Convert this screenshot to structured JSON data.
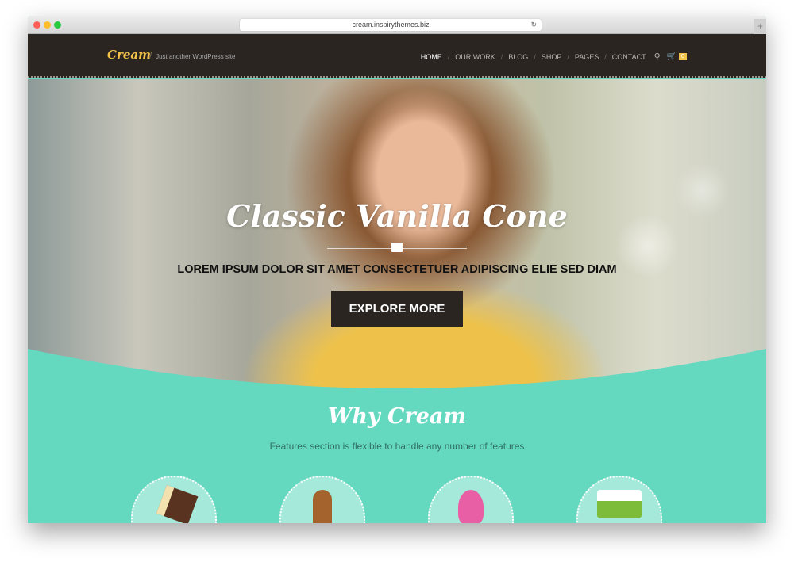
{
  "browser": {
    "url": "cream.inspirythemes.biz"
  },
  "header": {
    "logo": "Cream",
    "tagline": "Just another WordPress site",
    "menu": [
      "HOME",
      "OUR WORK",
      "BLOG",
      "SHOP",
      "PAGES",
      "CONTACT"
    ],
    "active": "HOME",
    "cart_count": "0"
  },
  "hero": {
    "title": "Classic Vanilla Cone",
    "subtitle": "LOREM IPSUM DOLOR SIT AMET CONSECTETUER ADIPISCING ELIE SED DIAM",
    "button": "EXPLORE MORE"
  },
  "features": {
    "title": "Why Cream",
    "subtitle": "Features section is flexible to handle any number of features",
    "icons": [
      "chocolate-cake-icon",
      "ice-cream-bar-icon",
      "pink-soft-serve-icon",
      "ice-cream-truck-icon"
    ]
  },
  "colors": {
    "accent": "#f2c24a",
    "teal": "#65d8c0",
    "dark": "#2a2521"
  }
}
